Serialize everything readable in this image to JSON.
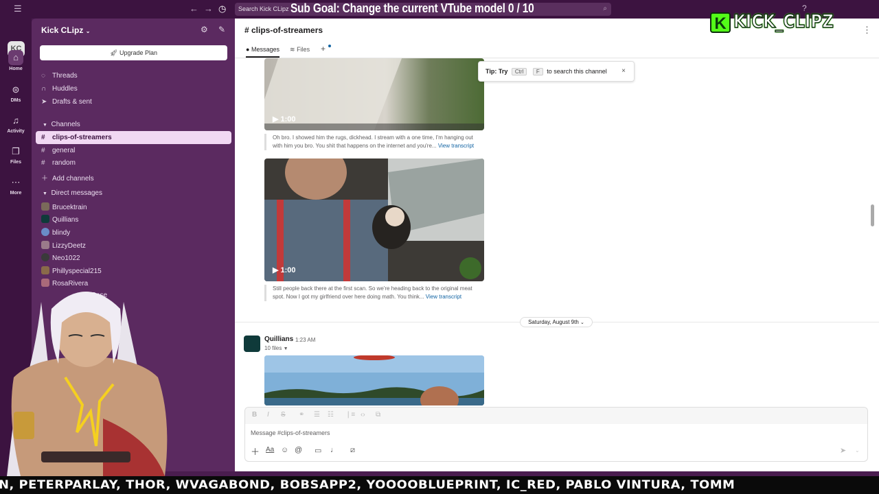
{
  "topbar": {
    "menu_icon": "hamburger-icon",
    "back_icon": "arrow-left-icon",
    "forward_icon": "arrow-right-icon",
    "history_icon": "clock-icon",
    "search_placeholder": "Search Kick CLipz",
    "help_icon": "help-icon"
  },
  "overlay": {
    "goal_text": "Sub Goal: Change the current VTube model  0 / 10",
    "logo_letter": "K",
    "logo_text": "KICK_CLIPZ"
  },
  "rail": {
    "workspace_initials": "KC",
    "items": [
      {
        "label": "Home",
        "icon": "home-icon"
      },
      {
        "label": "DMs",
        "icon": "dms-icon"
      },
      {
        "label": "Activity",
        "icon": "bell-icon"
      },
      {
        "label": "Files",
        "icon": "files-icon"
      },
      {
        "label": "More",
        "icon": "more-icon"
      }
    ]
  },
  "sidebar": {
    "workspace_name": "Kick CLipz",
    "upgrade_label": "Upgrade Plan",
    "nav": [
      {
        "label": "Threads",
        "icon": "threads-icon"
      },
      {
        "label": "Huddles",
        "icon": "headphones-icon"
      },
      {
        "label": "Drafts & sent",
        "icon": "send-icon"
      }
    ],
    "channels_header": "Channels",
    "channels": [
      "clips-of-streamers",
      "general",
      "random"
    ],
    "add_channels": "Add channels",
    "dm_header": "Direct messages",
    "dms": [
      {
        "name": "Brucektrain",
        "color": "#7a6a5a"
      },
      {
        "name": "Quillians",
        "color": "#0f3a3a"
      },
      {
        "name": "blindy",
        "color": "#6a8cc8"
      },
      {
        "name": "LizzyDeetz",
        "color": "#9a7a8a"
      },
      {
        "name": "Neo1022",
        "color": "#3a3a3a"
      },
      {
        "name": "Phillyspecial215",
        "color": "#8a6a4a"
      },
      {
        "name": "RosaRivera",
        "color": "#aa6a7a"
      },
      {
        "name": "tRose",
        "color": "#c8a0b0"
      }
    ]
  },
  "main": {
    "channel_title": "# clips-of-streamers",
    "tab_messages": "Messages",
    "tab_files": "Files",
    "tip": {
      "prefix": "Tip: Try",
      "key1": "Ctrl",
      "key2": "F",
      "suffix": "to search this channel"
    },
    "video1": {
      "duration": "1:00"
    },
    "caption1": {
      "line1": "Oh bro. I showed him the rugs, dickhead. I stream with a one time, I'm hanging out",
      "line2": "with him you bro. You shit that happens on the internet and you're...",
      "link": "View transcript"
    },
    "video2": {
      "duration": "1:00"
    },
    "caption2": {
      "line1": "Still people back there at the first scan. So we're heading back to the original meat",
      "line2": "spot. Now I got my girlfriend over here doing math. You think...",
      "link": "View transcript"
    },
    "date_divider": "Saturday, August 9th",
    "message": {
      "author": "Quillians",
      "time": "1:23 AM",
      "files": "10 files"
    },
    "composer_placeholder": "Message #clips-of-streamers"
  },
  "ticker": {
    "text": "N, PETERPARLAY, THOR, WVAGABOND, BOBSAPP2, YOOOOBLUEPRINT, IC_RED, PABLO VINTURA, TOMM"
  }
}
